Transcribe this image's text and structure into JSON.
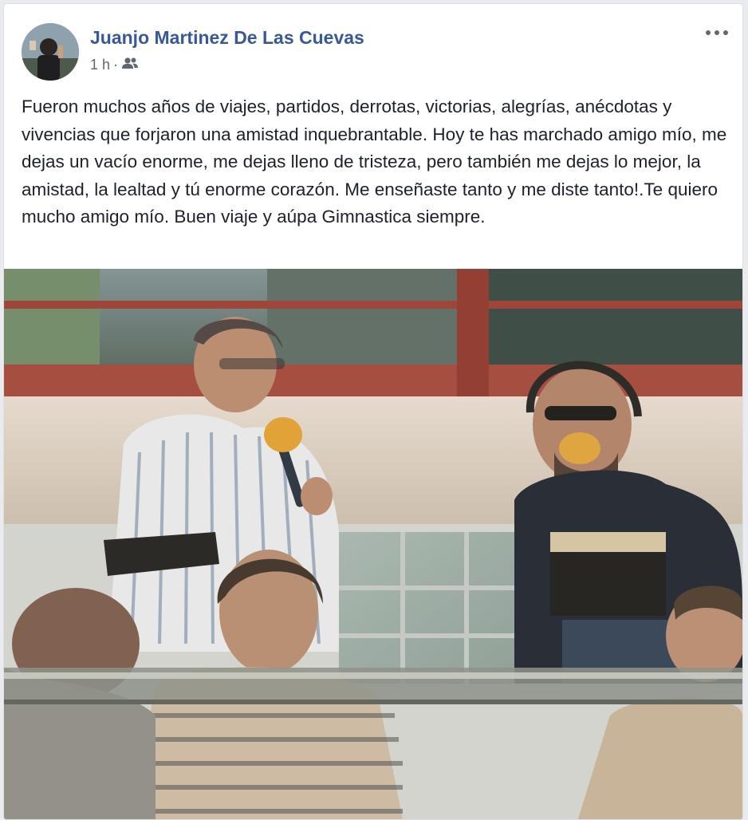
{
  "post": {
    "author": "Juanjo Martinez De Las Cuevas",
    "timestamp": "1 h",
    "separator": "·",
    "audience_icon": "friends-icon",
    "more_icon": "more-options-icon",
    "text": "Fueron muchos años de viajes, partidos, derrotas, victorias, alegrías, anécdotas y vivencias que forjaron una amistad inquebrantable. Hoy te has marchado amigo mío, me dejas un vacío enorme, me dejas lleno de tristeza, pero también me dejas lo mejor, la amistad, la lealtad y tú enorme corazón. Me enseñaste tanto y me diste tanto!.Te quiero mucho amigo mío. Buen viaje y aúpa Gimnastica siempre."
  },
  "colors": {
    "author_link": "#385898",
    "meta_text": "#606770",
    "body_text": "#1d2129",
    "page_bg": "#e9ebee"
  }
}
